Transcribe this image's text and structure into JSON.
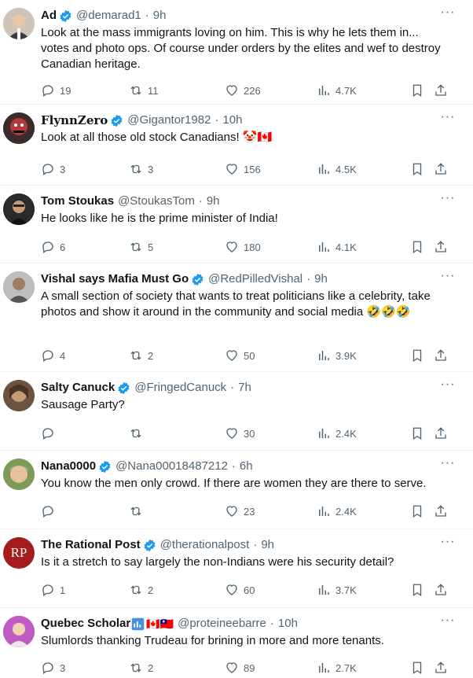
{
  "posts": [
    {
      "name": "Ad",
      "handle": "@demarad1",
      "time": "9h",
      "verified": true,
      "text": "Look at the mass immigrants loving on him.  This is why he lets them in... votes and photo ops.  Of course under orders by the elites and wef to destroy Canadian heritage.",
      "replies": "19",
      "reposts": "11",
      "likes": "226",
      "views": "4.7K",
      "avatar_color": "#d9c6b4"
    },
    {
      "name": "𝐅𝐥𝐲𝐧𝐧𝐙𝐞𝐫𝐨",
      "handle": "@Gigantor1982",
      "time": "10h",
      "verified": true,
      "text": "Look at all those old stock Canadians! 🤡🇨🇦",
      "replies": "3",
      "reposts": "3",
      "likes": "156",
      "views": "4.5K",
      "avatar_color": "#5d2a2a"
    },
    {
      "name": "Tom Stoukas",
      "handle": "@StoukasTom",
      "time": "9h",
      "verified": false,
      "text": "He looks like he is the prime minister of India!",
      "replies": "6",
      "reposts": "5",
      "likes": "180",
      "views": "4.1K",
      "avatar_color": "#2f2f2f"
    },
    {
      "name": "Vishal says Mafia Must Go",
      "handle": "@RedPilledVishal",
      "time": "9h",
      "verified": true,
      "text": "A small section of society that wants to treat politicians like a celebrity, take photos and show it around in the community and social media 🤣🤣🤣",
      "replies": "4",
      "reposts": "2",
      "likes": "50",
      "views": "3.9K",
      "avatar_color": "#9a9a9a"
    },
    {
      "name": "Salty Canuck",
      "handle": "@FringedCanuck",
      "time": "7h",
      "verified": true,
      "text": "Sausage Party?",
      "replies": "",
      "reposts": "",
      "likes": "30",
      "views": "2.4K",
      "avatar_color": "#8b6a4f"
    },
    {
      "name": "Nana0000",
      "handle": "@Nana00018487212",
      "time": "6h",
      "verified": true,
      "text": "You know the men only crowd. If there are women they are there to serve.",
      "replies": "",
      "reposts": "",
      "likes": "23",
      "views": "2.4K",
      "avatar_color": "#c79a6e"
    },
    {
      "name": "The Rational Post",
      "handle": "@therationalpost",
      "time": "9h",
      "verified": true,
      "text": "Is it a stretch to say largely the non-Indians were his security detail?",
      "replies": "1",
      "reposts": "2",
      "likes": "60",
      "views": "3.7K",
      "avatar_color": "#a51c1c",
      "avatar_text": "RP"
    },
    {
      "name": "Quebec Scholar",
      "handle": "@proteineebarre",
      "time": "10h",
      "verified": false,
      "name_flags": "🇨🇦🇹🇼",
      "text": "Slumlords thanking Trudeau for brining in more and more tenants.",
      "replies": "3",
      "reposts": "2",
      "likes": "89",
      "views": "2.7K",
      "avatar_color": "#b04fb3"
    }
  ],
  "colors": {
    "verified": "#1d9bf0",
    "muted": "#536471",
    "text": "#0f1419"
  }
}
